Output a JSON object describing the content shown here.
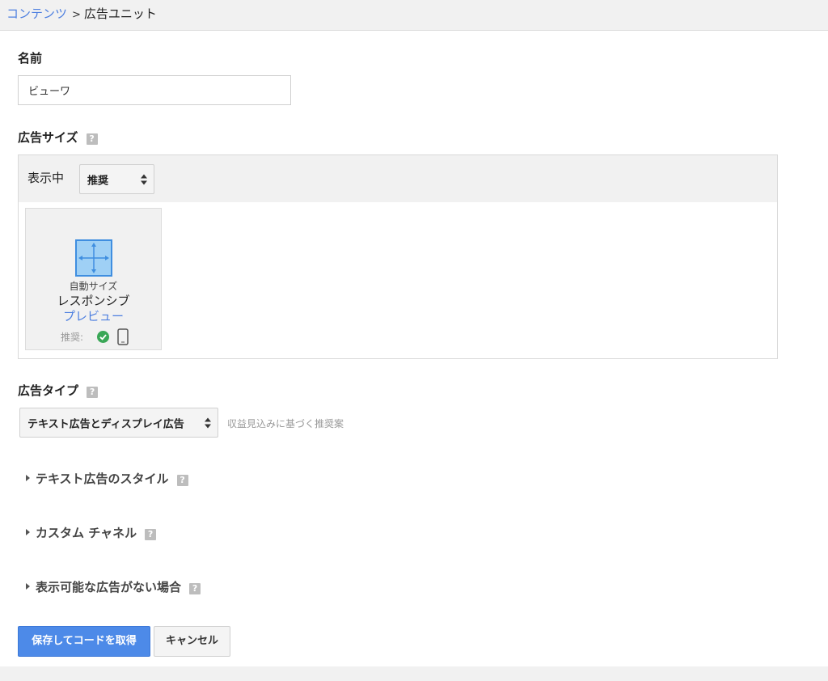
{
  "breadcrumb": {
    "parent": "コンテンツ",
    "separator": ">",
    "current": "広告ユニット"
  },
  "name_section": {
    "label": "名前",
    "input_value": "ビューワ"
  },
  "ad_size": {
    "label": "広告サイズ",
    "help": "?",
    "display_label": "表示中",
    "filter_value": "推奨",
    "card": {
      "auto_label": "自動サイズ",
      "title": "レスポンシブ",
      "preview_link": "プレビュー",
      "recommend_label": "推奨:",
      "icon": "responsive-resize-icon"
    }
  },
  "ad_type": {
    "label": "広告タイプ",
    "help": "?",
    "select_value": "テキスト広告とディスプレイ広告",
    "hint": "収益見込みに基づく推奨案"
  },
  "collapsible_sections": [
    {
      "label": "テキスト広告のスタイル",
      "help": "?"
    },
    {
      "label": "カスタム チャネル",
      "help": "?"
    },
    {
      "label": "表示可能な広告がない場合",
      "help": "?"
    }
  ],
  "buttons": {
    "save": "保存してコードを取得",
    "cancel": "キャンセル"
  },
  "colors": {
    "link": "#4d7fe0",
    "primary_button": "#4d8ae8",
    "check_green": "#3aa757",
    "responsive_icon_fill": "#9fd0f5",
    "responsive_icon_border": "#3f8ee0"
  }
}
